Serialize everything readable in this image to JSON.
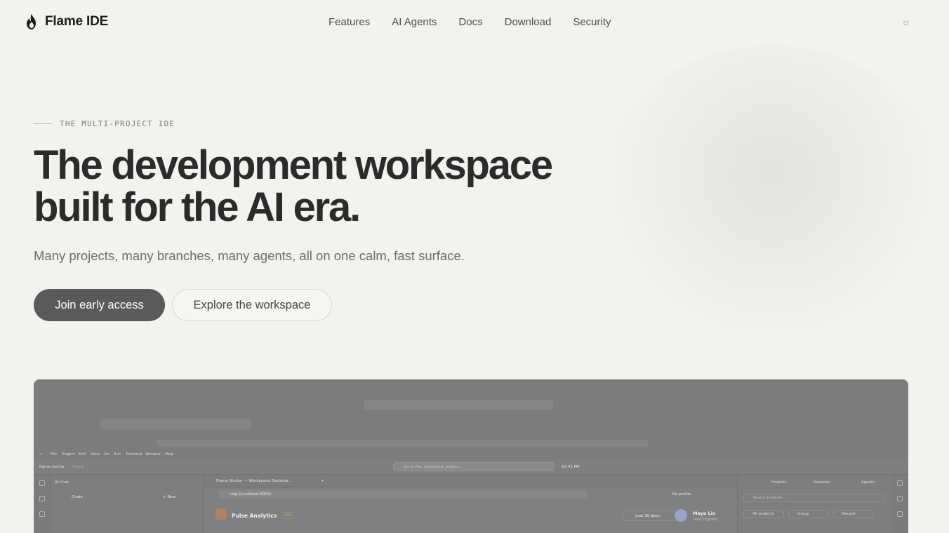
{
  "brand": {
    "name": "Flame IDE"
  },
  "nav": {
    "items": [
      "Features",
      "AI Agents",
      "Docs",
      "Download",
      "Security"
    ]
  },
  "theme_toggle": "☼",
  "hero": {
    "eyebrow": "THE MULTI-PROJECT IDE",
    "title_line1": "The development workspace",
    "title_line2": "built for the AI era.",
    "subtitle": "Many projects, many branches, many agents, all on one calm, fast surface.",
    "primary_cta": "Join early access",
    "secondary_cta": "Explore the workspace"
  },
  "preview": {
    "menu": [
      "File",
      "Project",
      "Edit",
      "View",
      "Go",
      "Run",
      "Terminal",
      "Window",
      "Help"
    ],
    "project_name": "flame-starter",
    "project_badge": "flame",
    "command_placeholder": "Go to file, command, project...",
    "time": "10:41 PM",
    "chat_title": "AI Chat",
    "chats_label": "Chats",
    "new_label": "+ New",
    "tab_title": "Flame Starter — Workspace Dashboa...",
    "url": "http://localhost:3000/",
    "no_profile": "No profile",
    "app_title": "Pulse Analytics",
    "app_badge": "PRO",
    "date_range": "Last 30 days",
    "user_name": "Maya Lin",
    "user_role": "Lead Engineer",
    "right_tabs": [
      "Projects",
      "Sessions",
      "Agents"
    ],
    "search_projects": "Search projects...",
    "filters": [
      "All projects",
      "Group",
      "Recent"
    ]
  },
  "colors": {
    "background": "#f3f2ee",
    "primary_button": "#5a5a5a",
    "preview_overlay": "#7c7c7c"
  }
}
